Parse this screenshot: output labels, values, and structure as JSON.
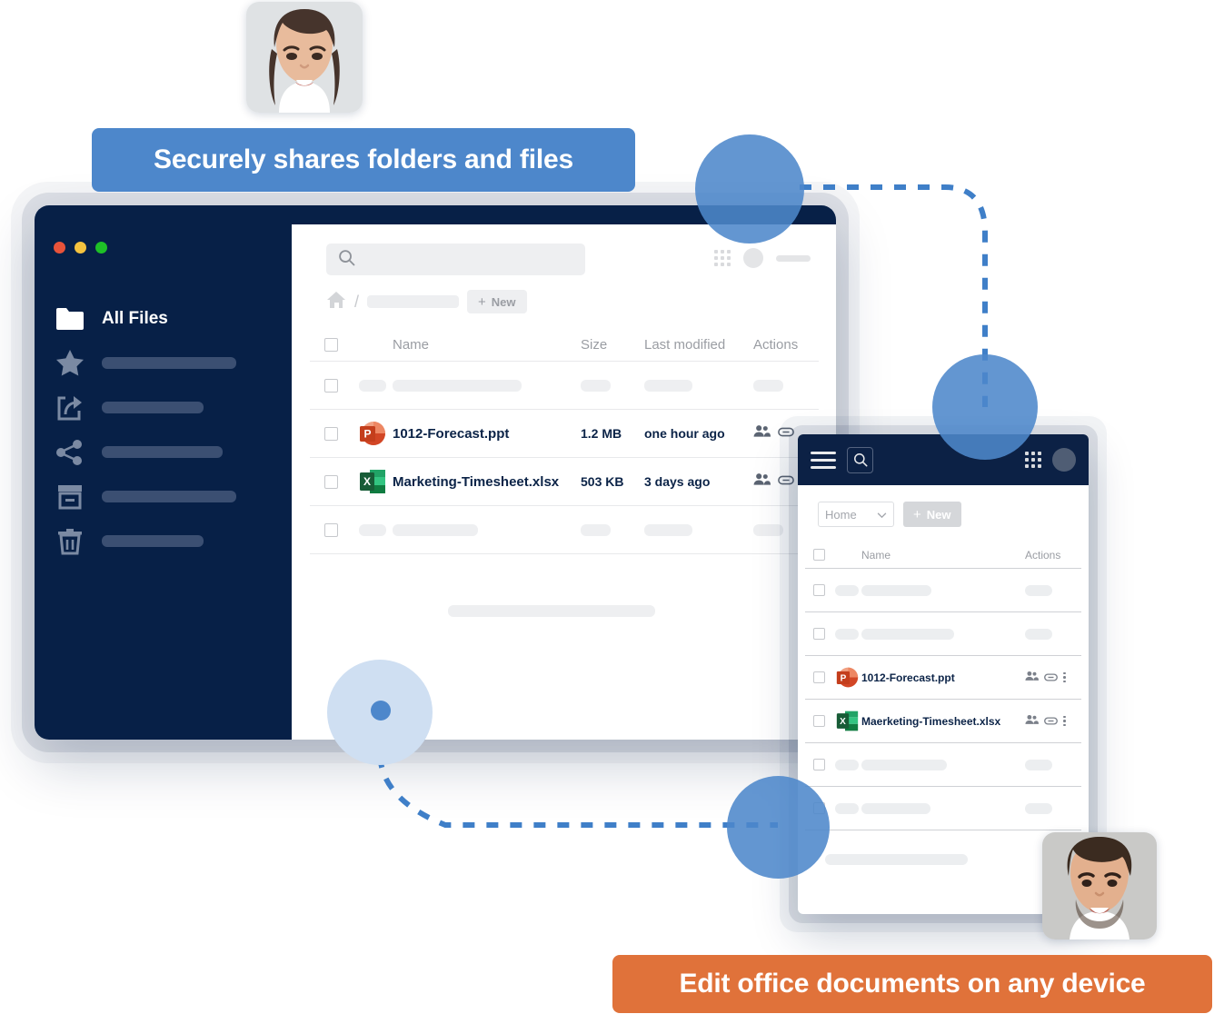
{
  "callouts": {
    "top": "Securely shares folders and files",
    "bottom": "Edit office documents on any device",
    "top_color": "#4d87cb",
    "bottom_color": "#e0723a"
  },
  "avatars": {
    "woman_name": "woman-avatar-photo",
    "man_name": "man-avatar-photo"
  },
  "desktop": {
    "window_color": "#072047",
    "traffic_lights": [
      "close",
      "minimize",
      "maximize"
    ],
    "sidebar": {
      "items": [
        {
          "icon": "folder-icon",
          "label": "All Files"
        },
        {
          "icon": "star-icon",
          "label": ""
        },
        {
          "icon": "share-export-icon",
          "label": ""
        },
        {
          "icon": "share-nodes-icon",
          "label": ""
        },
        {
          "icon": "archive-icon",
          "label": ""
        },
        {
          "icon": "trash-icon",
          "label": ""
        }
      ]
    },
    "search": {
      "placeholder": "",
      "value": "",
      "icon": "search-icon"
    },
    "breadcrumb": {
      "home_icon": "home-icon",
      "separator": "/"
    },
    "new_button": {
      "label": "New",
      "plus": "+"
    },
    "table": {
      "columns": [
        "",
        "",
        "Name",
        "Size",
        "Last modified",
        "Actions"
      ],
      "headers": {
        "name": "Name",
        "size": "Size",
        "modified": "Last modified",
        "actions": "Actions"
      },
      "rows": [
        {
          "type": "skeleton"
        },
        {
          "type": "file",
          "icon": "powerpoint-icon",
          "name": "1012-Forecast.ppt",
          "size": "1.2 MB",
          "modified": "one hour ago",
          "actions": [
            "share-users-icon",
            "link-icon"
          ]
        },
        {
          "type": "file",
          "icon": "excel-icon",
          "name": "Marketing-Timesheet.xlsx",
          "size": "503 KB",
          "modified": "3 days ago",
          "actions": [
            "share-users-icon",
            "link-icon"
          ]
        },
        {
          "type": "skeleton"
        }
      ]
    }
  },
  "mobile": {
    "topbar": {
      "menu_icon": "hamburger-menu-icon",
      "search_icon": "search-icon",
      "grid_icon": "app-grid-icon",
      "avatar_icon": "user-avatar-icon"
    },
    "toolbar": {
      "select_value": "Home",
      "chevron": "chevron-down-icon",
      "new_label": "New",
      "plus": "+"
    },
    "table": {
      "headers": {
        "name": "Name",
        "actions": "Actions"
      },
      "rows": [
        {
          "type": "skeleton"
        },
        {
          "type": "skeleton"
        },
        {
          "type": "file",
          "icon": "powerpoint-icon",
          "name": "1012-Forecast.ppt",
          "actions": [
            "share-users-icon",
            "link-icon",
            "more-vertical-icon"
          ]
        },
        {
          "type": "file",
          "icon": "excel-icon",
          "name": "Maerketing-Timesheet.xlsx",
          "actions": [
            "share-users-icon",
            "link-icon",
            "more-vertical-icon"
          ]
        },
        {
          "type": "skeleton"
        },
        {
          "type": "skeleton"
        }
      ]
    }
  },
  "decoration": {
    "circle_color": "#4d87cb",
    "pale_circle_color": "#cfdff2",
    "connector_style": "dotted"
  }
}
